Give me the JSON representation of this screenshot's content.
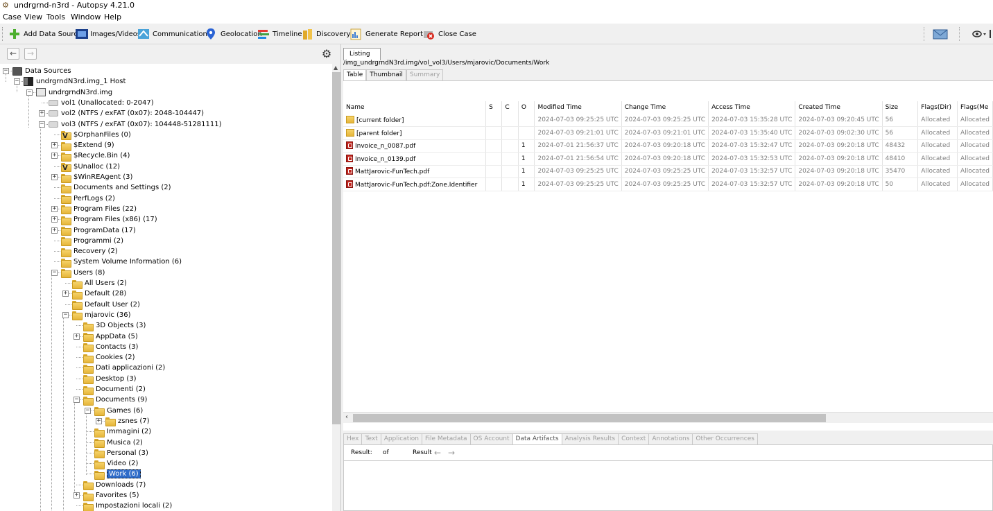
{
  "window": {
    "title": "undrgrnd-n3rd - Autopsy 4.21.0"
  },
  "menu": [
    "Case",
    "View",
    "Tools",
    "Window",
    "Help"
  ],
  "toolbar": {
    "add_data_source": "Add Data Source",
    "images_videos": "Images/Videos",
    "communications": "Communications",
    "geolocation": "Geolocation",
    "timeline": "Timeline",
    "discovery": "Discovery",
    "generate_report": "Generate Report",
    "close_case": "Close Case"
  },
  "tree": {
    "items": [
      {
        "label": "Data Sources"
      },
      {
        "label": "undrgrndN3rd.img_1 Host"
      },
      {
        "label": "undrgrndN3rd.img"
      },
      {
        "label": "vol1 (Unallocated: 0-2047)"
      },
      {
        "label": "vol2 (NTFS / exFAT (0x07): 2048-104447)"
      },
      {
        "label": "vol3 (NTFS / exFAT (0x07): 104448-51281111)"
      },
      {
        "label": "$OrphanFiles (0)"
      },
      {
        "label": "$Extend (9)"
      },
      {
        "label": "$Recycle.Bin (4)"
      },
      {
        "label": "$Unalloc (12)"
      },
      {
        "label": "$WinREAgent (3)"
      },
      {
        "label": "Documents and Settings (2)"
      },
      {
        "label": "PerfLogs (2)"
      },
      {
        "label": "Program Files (22)"
      },
      {
        "label": "Program Files (x86) (17)"
      },
      {
        "label": "ProgramData (17)"
      },
      {
        "label": "Programmi (2)"
      },
      {
        "label": "Recovery (2)"
      },
      {
        "label": "System Volume Information (6)"
      },
      {
        "label": "Users (8)"
      },
      {
        "label": "All Users (2)"
      },
      {
        "label": "Default (28)"
      },
      {
        "label": "Default User (2)"
      },
      {
        "label": "mjarovic (36)"
      },
      {
        "label": "3D Objects (3)"
      },
      {
        "label": "AppData (5)"
      },
      {
        "label": "Contacts (3)"
      },
      {
        "label": "Cookies (2)"
      },
      {
        "label": "Dati applicazioni (2)"
      },
      {
        "label": "Desktop (3)"
      },
      {
        "label": "Documenti (2)"
      },
      {
        "label": "Documents (9)"
      },
      {
        "label": "Games (6)"
      },
      {
        "label": "zsnes (7)"
      },
      {
        "label": "Immagini (2)"
      },
      {
        "label": "Musica (2)"
      },
      {
        "label": "Personal (3)"
      },
      {
        "label": "Video (2)"
      },
      {
        "label": "Work (6)"
      },
      {
        "label": "Downloads (7)"
      },
      {
        "label": "Favorites (5)"
      },
      {
        "label": "Impostazioni locali (2)"
      }
    ]
  },
  "listing": {
    "tab": "Listing",
    "path": "/img_undrgrndN3rd.img/vol_vol3/Users/mjarovic/Documents/Work",
    "view_tabs": [
      "Table",
      "Thumbnail",
      "Summary"
    ],
    "columns": [
      "Name",
      "S",
      "C",
      "O",
      "Modified Time",
      "Change Time",
      "Access Time",
      "Created Time",
      "Size",
      "Flags(Dir)",
      "Flags(Me"
    ],
    "rows": [
      {
        "name": "[current folder]",
        "s": "",
        "c": "",
        "o": "",
        "modified": "2024-07-03 09:25:25 UTC",
        "changed": "2024-07-03 09:25:25 UTC",
        "accessed": "2024-07-03 15:35:28 UTC",
        "created": "2024-07-03 09:20:45 UTC",
        "size": "56",
        "flags_dir": "Allocated",
        "flags_meta": "Allocated"
      },
      {
        "name": "[parent folder]",
        "s": "",
        "c": "",
        "o": "",
        "modified": "2024-07-03 09:21:01 UTC",
        "changed": "2024-07-03 09:21:01 UTC",
        "accessed": "2024-07-03 15:35:40 UTC",
        "created": "2024-07-03 09:02:30 UTC",
        "size": "56",
        "flags_dir": "Allocated",
        "flags_meta": "Allocated"
      },
      {
        "name": "Invoice_n_0087.pdf",
        "s": "",
        "c": "",
        "o": "1",
        "modified": "2024-07-01 21:56:37 UTC",
        "changed": "2024-07-03 09:20:18 UTC",
        "accessed": "2024-07-03 15:32:47 UTC",
        "created": "2024-07-03 09:20:18 UTC",
        "size": "48432",
        "flags_dir": "Allocated",
        "flags_meta": "Allocated"
      },
      {
        "name": "Invoice_n_0139.pdf",
        "s": "",
        "c": "",
        "o": "1",
        "modified": "2024-07-01 21:56:54 UTC",
        "changed": "2024-07-03 09:20:18 UTC",
        "accessed": "2024-07-03 15:32:53 UTC",
        "created": "2024-07-03 09:20:18 UTC",
        "size": "48410",
        "flags_dir": "Allocated",
        "flags_meta": "Allocated"
      },
      {
        "name": "MattJarovic-FunTech.pdf",
        "s": "",
        "c": "",
        "o": "1",
        "modified": "2024-07-03 09:25:25 UTC",
        "changed": "2024-07-03 09:25:25 UTC",
        "accessed": "2024-07-03 15:32:57 UTC",
        "created": "2024-07-03 09:20:18 UTC",
        "size": "35470",
        "flags_dir": "Allocated",
        "flags_meta": "Allocated"
      },
      {
        "name": "MattJarovic-FunTech.pdf:Zone.Identifier",
        "s": "",
        "c": "",
        "o": "1",
        "modified": "2024-07-03 09:25:25 UTC",
        "changed": "2024-07-03 09:25:25 UTC",
        "accessed": "2024-07-03 15:32:57 UTC",
        "created": "2024-07-03 09:20:18 UTC",
        "size": "50",
        "flags_dir": "Allocated",
        "flags_meta": "Allocated"
      }
    ]
  },
  "bottom_tabs": [
    "Hex",
    "Text",
    "Application",
    "File Metadata",
    "OS Account",
    "Data Artifacts",
    "Analysis Results",
    "Context",
    "Annotations",
    "Other Occurrences"
  ],
  "result_bar": {
    "result": "Result:",
    "of": "of",
    "result2": "Result"
  },
  "colors": {
    "selection": "#2f6cc9",
    "folder": "#f2c94c",
    "pdf": "#c0241d"
  }
}
